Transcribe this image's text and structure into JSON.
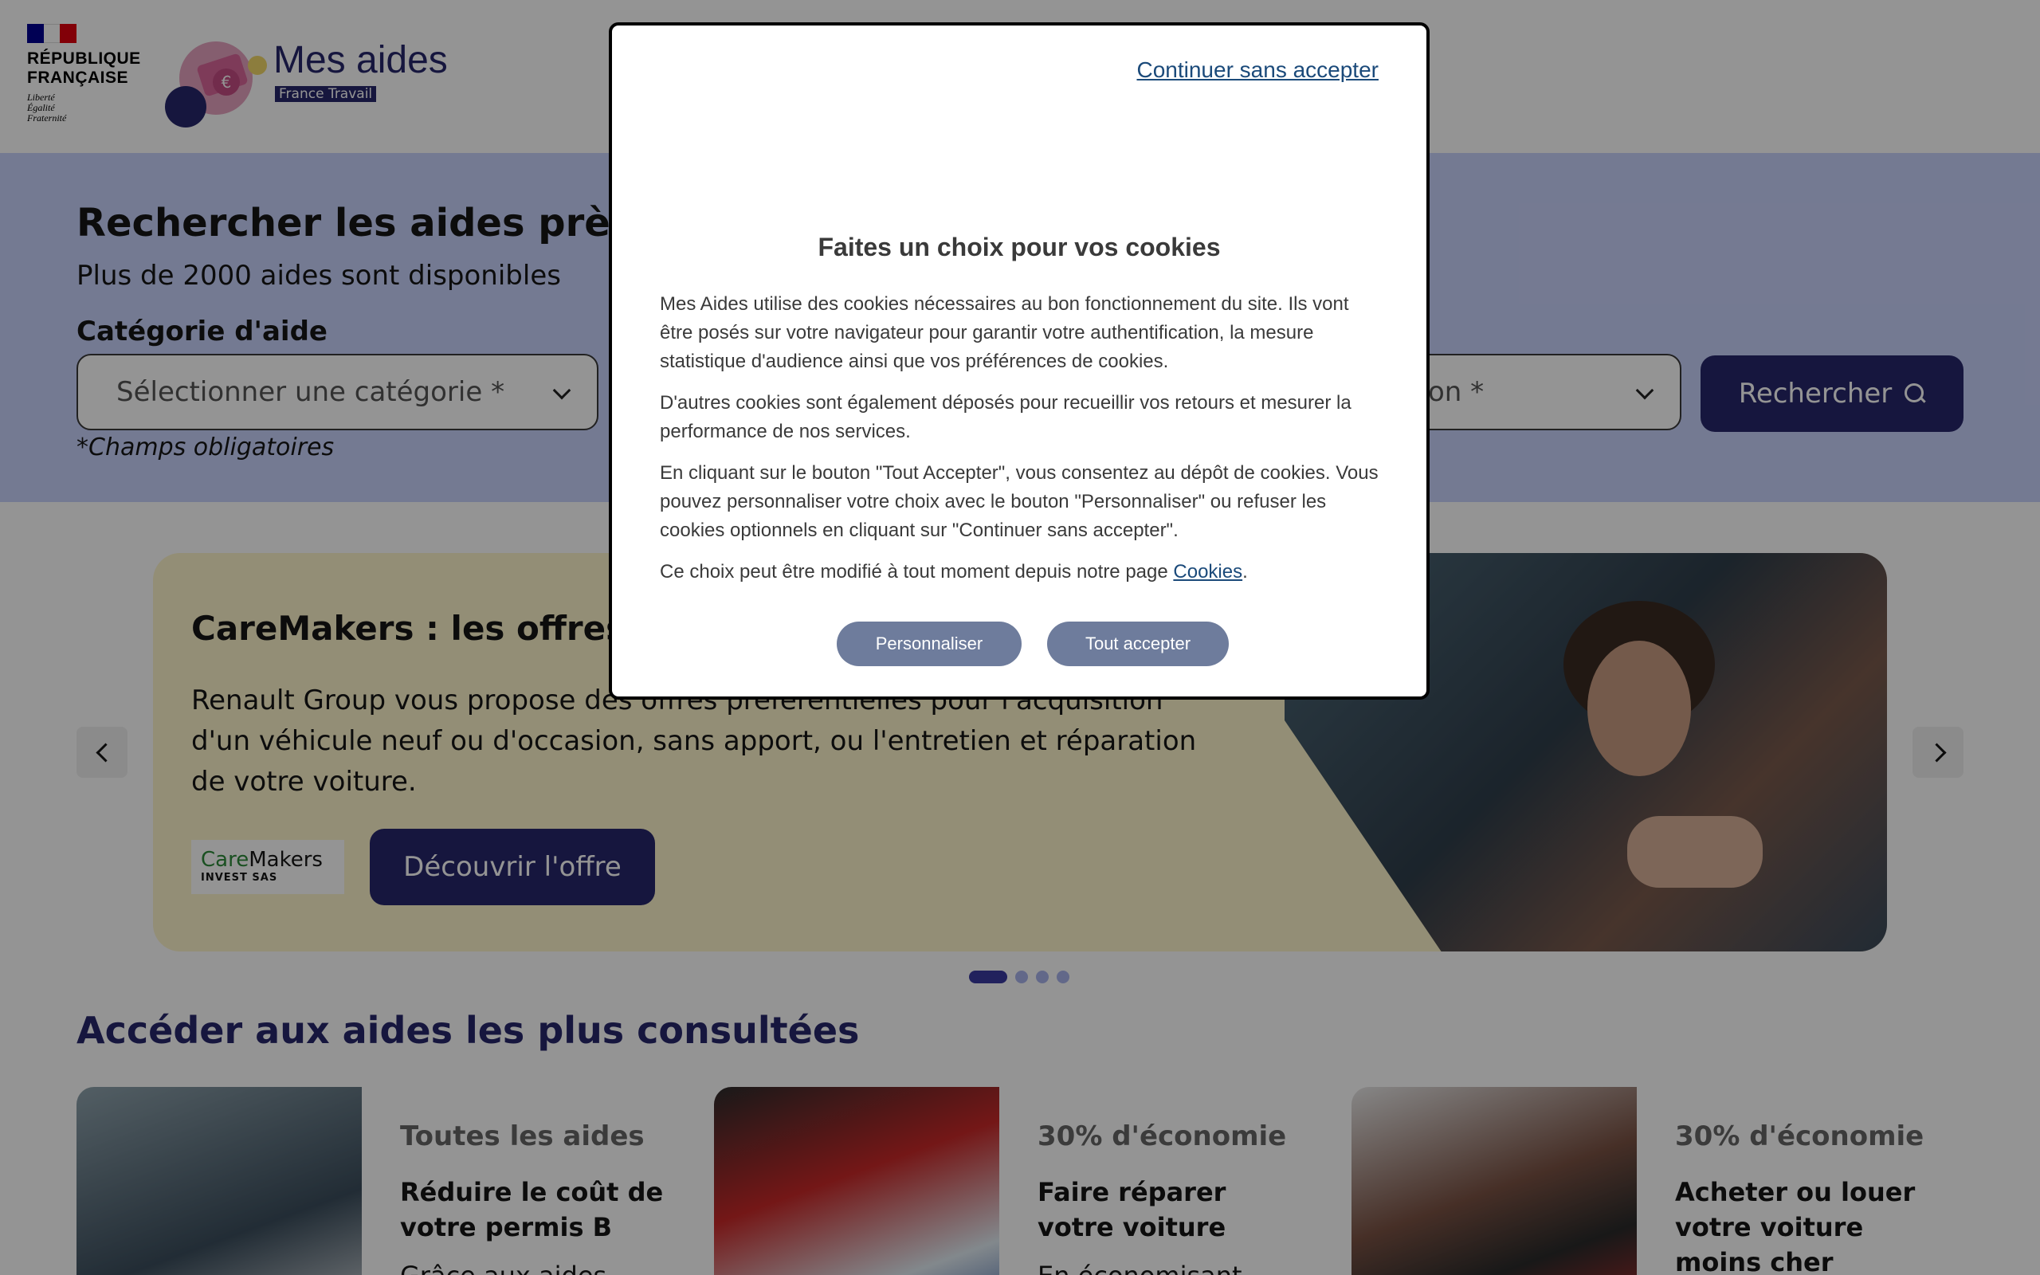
{
  "header": {
    "republic": {
      "name_line1": "RÉPUBLIQUE",
      "name_line2": "FRANÇAISE",
      "motto_line1": "Liberté",
      "motto_line2": "Égalité",
      "motto_line3": "Fraternité",
      "flag_colors": [
        "#000091",
        "#ffffff",
        "#e1000f"
      ]
    },
    "brand": {
      "title": "Mes aides",
      "subtitle": "France Travail",
      "euro_symbol": "€"
    }
  },
  "search": {
    "title": "Rechercher les aides près de",
    "subtitle": "Plus de 2000 aides sont disponibles",
    "category_label": "Catégorie d'aide",
    "category_placeholder": "Sélectionner une catégorie *",
    "location_placeholder_visible": "on *",
    "button_label": "Rechercher",
    "required_note": "*Champs obligatoires"
  },
  "carousel": {
    "title": "CareMakers : les offres de R",
    "description": "Renault Group vous propose des offres préférentielles pour l'acquisition d'un véhicule neuf ou d'occasion, sans apport, ou l'entretien et réparation de votre voiture.",
    "partner_logo": {
      "part1": "Care",
      "part2": "Makers",
      "tagline": "INVEST SAS"
    },
    "cta_label": "Découvrir l'offre",
    "slide_count": 4,
    "active_slide": 1
  },
  "popular": {
    "section_title": "Accéder aux aides les plus consultées",
    "cards": [
      {
        "tag": "Toutes les aides",
        "title": "Réduire le coût de votre permis B",
        "extra": "Grâce aux aides"
      },
      {
        "tag": "30% d'économie",
        "title": "Faire réparer votre voiture",
        "extra": "En économisant"
      },
      {
        "tag": "30% d'économie",
        "title": "Acheter ou louer votre voiture moins cher",
        "extra": ""
      }
    ]
  },
  "cookie_modal": {
    "continue_label": "Continuer sans accepter",
    "title": "Faites un choix pour vos cookies",
    "paragraph1": "Mes Aides utilise des cookies nécessaires au bon fonctionnement du site. Ils vont être posés sur votre navigateur pour garantir votre authentification, la mesure statistique d'audience ainsi que vos préférences de cookies.",
    "paragraph2": "D'autres cookies sont également déposés pour recueillir vos retours et mesurer la performance de nos services.",
    "paragraph3": "En cliquant sur le bouton \"Tout Accepter\", vous consentez au dépôt de cookies. Vous pouvez personnaliser votre choix avec le bouton \"Personnaliser\" ou refuser les cookies optionnels en cliquant sur \"Continuer sans accepter\".",
    "paragraph4_prefix": "Ce choix peut être modifié à tout moment depuis notre page ",
    "paragraph4_link": "Cookies",
    "paragraph4_suffix": ".",
    "btn_customize": "Personnaliser",
    "btn_accept_all": "Tout accepter"
  },
  "colors": {
    "brand_navy": "#27276b",
    "search_band": "#c9d3fb",
    "carousel_bg": "#fdf4cc",
    "modal_button": "#6e7c9c"
  }
}
